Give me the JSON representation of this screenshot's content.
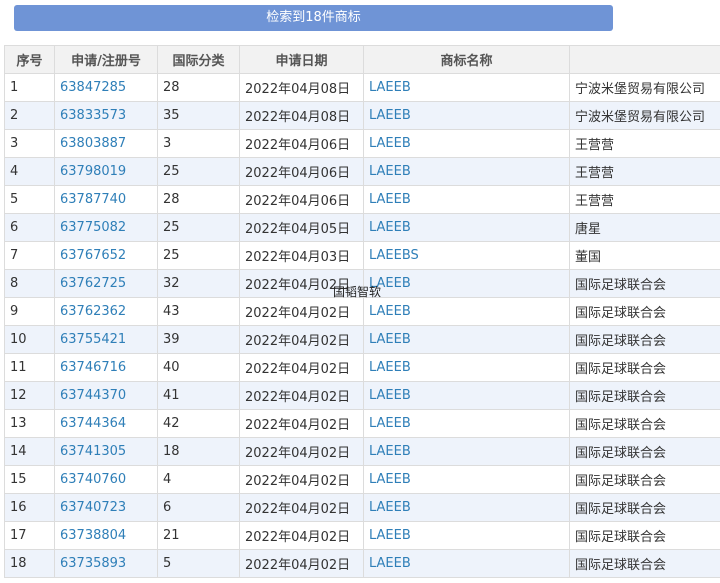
{
  "banner": {
    "text": "检索到18件商标"
  },
  "table": {
    "headers": [
      "序号",
      "申请/注册号",
      "国际分类",
      "申请日期",
      "商标名称",
      ""
    ],
    "rows": [
      {
        "no": "1",
        "reg": "63847285",
        "cls": "28",
        "date": "2022年04月08日",
        "name": "LAEEB",
        "applicant": "宁波米堡贸易有限公司"
      },
      {
        "no": "2",
        "reg": "63833573",
        "cls": "35",
        "date": "2022年04月08日",
        "name": "LAEEB",
        "applicant": "宁波米堡贸易有限公司"
      },
      {
        "no": "3",
        "reg": "63803887",
        "cls": "3",
        "date": "2022年04月06日",
        "name": "LAEEB",
        "applicant": "王营营"
      },
      {
        "no": "4",
        "reg": "63798019",
        "cls": "25",
        "date": "2022年04月06日",
        "name": "LAEEB",
        "applicant": "王营营"
      },
      {
        "no": "5",
        "reg": "63787740",
        "cls": "28",
        "date": "2022年04月06日",
        "name": "LAEEB",
        "applicant": "王营营"
      },
      {
        "no": "6",
        "reg": "63775082",
        "cls": "25",
        "date": "2022年04月05日",
        "name": "LAEEB",
        "applicant": "唐星"
      },
      {
        "no": "7",
        "reg": "63767652",
        "cls": "25",
        "date": "2022年04月03日",
        "name": "LAEEBS",
        "applicant": "董国"
      },
      {
        "no": "8",
        "reg": "63762725",
        "cls": "32",
        "date": "2022年04月02日",
        "name": "LAEEB",
        "applicant": "国际足球联合会"
      },
      {
        "no": "9",
        "reg": "63762362",
        "cls": "43",
        "date": "2022年04月02日",
        "name": "LAEEB",
        "applicant": "国际足球联合会"
      },
      {
        "no": "10",
        "reg": "63755421",
        "cls": "39",
        "date": "2022年04月02日",
        "name": "LAEEB",
        "applicant": "国际足球联合会"
      },
      {
        "no": "11",
        "reg": "63746716",
        "cls": "40",
        "date": "2022年04月02日",
        "name": "LAEEB",
        "applicant": "国际足球联合会"
      },
      {
        "no": "12",
        "reg": "63744370",
        "cls": "41",
        "date": "2022年04月02日",
        "name": "LAEEB",
        "applicant": "国际足球联合会"
      },
      {
        "no": "13",
        "reg": "63744364",
        "cls": "42",
        "date": "2022年04月02日",
        "name": "LAEEB",
        "applicant": "国际足球联合会"
      },
      {
        "no": "14",
        "reg": "63741305",
        "cls": "18",
        "date": "2022年04月02日",
        "name": "LAEEB",
        "applicant": "国际足球联合会"
      },
      {
        "no": "15",
        "reg": "63740760",
        "cls": "4",
        "date": "2022年04月02日",
        "name": "LAEEB",
        "applicant": "国际足球联合会"
      },
      {
        "no": "16",
        "reg": "63740723",
        "cls": "6",
        "date": "2022年04月02日",
        "name": "LAEEB",
        "applicant": "国际足球联合会"
      },
      {
        "no": "17",
        "reg": "63738804",
        "cls": "21",
        "date": "2022年04月02日",
        "name": "LAEEB",
        "applicant": "国际足球联合会"
      },
      {
        "no": "18",
        "reg": "63735893",
        "cls": "5",
        "date": "2022年04月02日",
        "name": "LAEEB",
        "applicant": "国际足球联合会"
      }
    ]
  },
  "watermark": {
    "text": "国韬智软"
  },
  "colors": {
    "banner": "#6f94d6",
    "link": "#2f7fb8",
    "stripe": "#eef3fb",
    "header_bg": "#f2f2f2"
  }
}
